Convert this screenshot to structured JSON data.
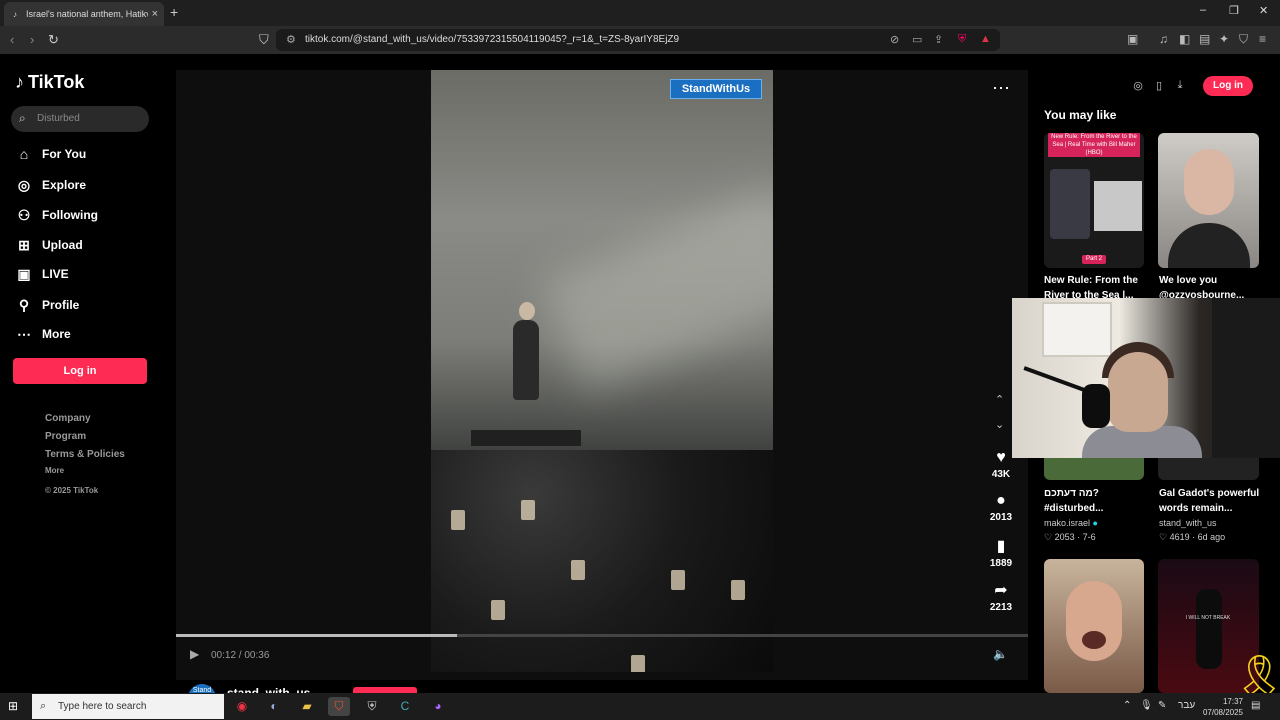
{
  "browser": {
    "tab_title": "Israel's national anthem, Hatikva",
    "tab_close": "×",
    "new_tab": "+",
    "url": "tiktok.com/@stand_with_us/video/7533972315504119045?_r=1&_t=ZS-8yarIY8EjZ9",
    "window_controls": [
      "–",
      "❐",
      "✕"
    ]
  },
  "sidebar": {
    "logo": "TikTok",
    "search_placeholder": "Disturbed",
    "nav": [
      {
        "label": "For You",
        "icon": "home-icon"
      },
      {
        "label": "Explore",
        "icon": "compass-icon"
      },
      {
        "label": "Following",
        "icon": "following-icon"
      },
      {
        "label": "Upload",
        "icon": "upload-icon"
      },
      {
        "label": "LIVE",
        "icon": "live-icon"
      },
      {
        "label": "Profile",
        "icon": "profile-icon"
      },
      {
        "label": "More",
        "icon": "more-icon"
      }
    ],
    "login_label": "Log in",
    "footer": {
      "company": "Company",
      "program": "Program",
      "terms": "Terms & Policies",
      "more": "More",
      "copyright": "© 2025 TikTok"
    }
  },
  "video": {
    "brand_tag": "StandWithUs",
    "time": "00:12 / 00:36",
    "progress": 0.33,
    "author": "stand_with_us",
    "actions": {
      "likes": "43K",
      "comments": "2013",
      "saves": "1889",
      "shares": "2213"
    }
  },
  "right_panel": {
    "login_label": "Log in",
    "heading": "You may like",
    "videos": [
      {
        "title": "New Rule: From the River to the Sea |...",
        "thumb_text": "New Rule: From the River to the Sea | Real Time with Bill Maher (HBO)",
        "badge": "Part 2"
      },
      {
        "title": "We love you @ozzyosbourne..."
      },
      {
        "title": "מה דעתכם? #disturbed...",
        "author": "mako.israel",
        "likes": "2053",
        "date": "7-6"
      },
      {
        "title": "Gal Gadot's powerful words remain...",
        "author": "stand_with_us",
        "likes": "4619",
        "date": "6d ago"
      },
      {
        "thumb_text": "I WILL NOT BREAK"
      }
    ]
  },
  "taskbar": {
    "search_placeholder": "Type here to search",
    "time": "17:37",
    "date": "07/08/2025",
    "lang": "עבר"
  },
  "colors": {
    "accent": "#fe2c55",
    "brand_tag": "#1a6fc0",
    "ribbon": "#f5d21a"
  }
}
